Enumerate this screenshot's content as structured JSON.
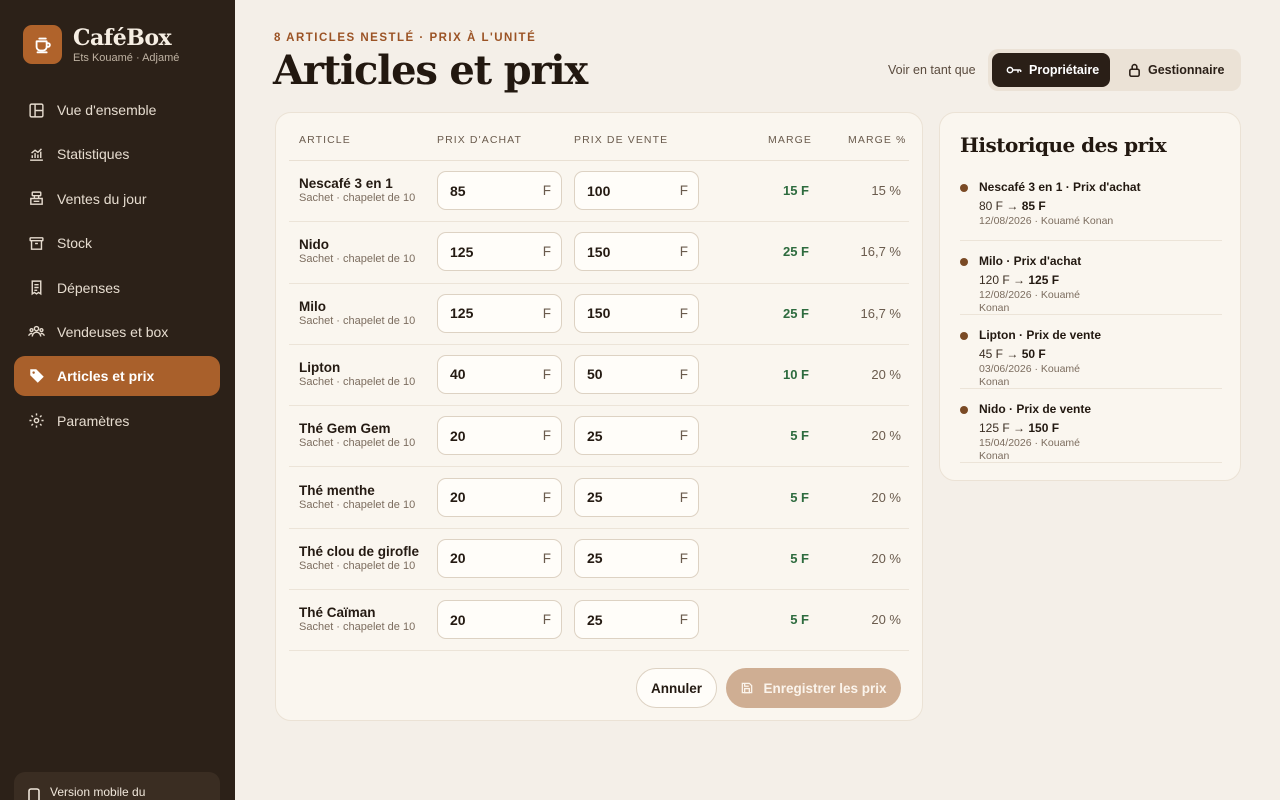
{
  "brand": {
    "name": "CaféBox",
    "subtitle": "Ets Kouamé · Adjamé"
  },
  "nav": [
    {
      "label": "Vue d'ensemble",
      "icon": "layout-icon",
      "active": false
    },
    {
      "label": "Statistiques",
      "icon": "chart-icon",
      "active": false
    },
    {
      "label": "Ventes du jour",
      "icon": "register-icon",
      "active": false
    },
    {
      "label": "Stock",
      "icon": "archive-icon",
      "active": false
    },
    {
      "label": "Dépenses",
      "icon": "receipt-icon",
      "active": false
    },
    {
      "label": "Vendeuses et box",
      "icon": "users-icon",
      "active": false
    },
    {
      "label": "Articles et prix",
      "icon": "tag-icon",
      "active": true
    },
    {
      "label": "Paramètres",
      "icon": "gear-icon",
      "active": false
    }
  ],
  "mobile_card": {
    "label": "Version mobile du"
  },
  "header": {
    "eyebrow": "8 ARTICLES NESTLÉ · PRIX À L'UNITÉ",
    "title": "Articles et prix",
    "view_as": "Voir en tant que",
    "roles": [
      "Propriétaire",
      "Gestionnaire"
    ],
    "active_role": "Propriétaire"
  },
  "table": {
    "columns": [
      "ARTICLE",
      "PRIX D'ACHAT",
      "PRIX DE VENTE",
      "MARGE",
      "MARGE %"
    ],
    "currency": "F",
    "rows": [
      {
        "name": "Nescafé 3 en 1",
        "unit": "Sachet · chapelet de 10",
        "buy": "85",
        "sell": "100",
        "marge": "15 F",
        "pct": "15 %"
      },
      {
        "name": "Nido",
        "unit": "Sachet · chapelet de 10",
        "buy": "125",
        "sell": "150",
        "marge": "25 F",
        "pct": "16,7 %"
      },
      {
        "name": "Milo",
        "unit": "Sachet · chapelet de 10",
        "buy": "125",
        "sell": "150",
        "marge": "25 F",
        "pct": "16,7 %"
      },
      {
        "name": "Lipton",
        "unit": "Sachet · chapelet de 10",
        "buy": "40",
        "sell": "50",
        "marge": "10 F",
        "pct": "20 %"
      },
      {
        "name": "Thé Gem Gem",
        "unit": "Sachet · chapelet de 10",
        "buy": "20",
        "sell": "25",
        "marge": "5 F",
        "pct": "20 %"
      },
      {
        "name": "Thé menthe",
        "unit": "Sachet · chapelet de 10",
        "buy": "20",
        "sell": "25",
        "marge": "5 F",
        "pct": "20 %"
      },
      {
        "name": "Thé clou de girofle",
        "unit": "Sachet · chapelet de 10",
        "buy": "20",
        "sell": "25",
        "marge": "5 F",
        "pct": "20 %"
      },
      {
        "name": "Thé Caïman",
        "unit": "Sachet · chapelet de 10",
        "buy": "20",
        "sell": "25",
        "marge": "5 F",
        "pct": "20 %"
      }
    ],
    "cancel_label": "Annuler",
    "save_label": "Enregistrer les prix"
  },
  "history": {
    "title": "Historique des prix",
    "items": [
      {
        "head": "Nescafé 3 en 1 · Prix d'achat",
        "from": "80 F",
        "to": "85 F",
        "meta": [
          "12/08/2026 · Kouamé Konan"
        ]
      },
      {
        "head": "Milo · Prix d'achat",
        "from": "120 F",
        "to": "125 F",
        "meta": [
          "12/08/2026 · Kouamé",
          "Konan"
        ]
      },
      {
        "head": "Lipton · Prix de vente",
        "from": "45 F",
        "to": "50 F",
        "meta": [
          "03/06/2026 · Kouamé",
          "Konan"
        ]
      },
      {
        "head": "Nido · Prix de vente",
        "from": "125 F",
        "to": "150 F",
        "meta": [
          "15/04/2026 · Kouamé",
          "Konan"
        ]
      }
    ]
  },
  "colors": {
    "sidebar": "#2c2118",
    "accent": "#a9602b",
    "margin_green": "#2d6b3e",
    "save_disabled": "#cfae93"
  }
}
